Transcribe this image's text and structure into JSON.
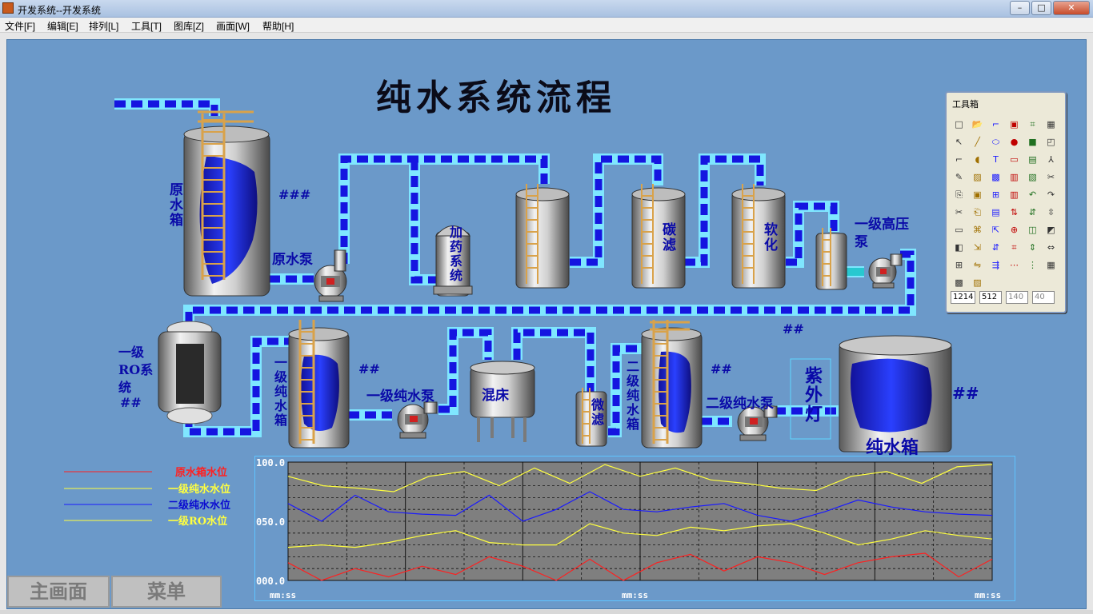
{
  "window": {
    "title": "开发系统--开发系统",
    "min": "–",
    "max": "□",
    "close": "✕"
  },
  "menu": [
    "文件[F]",
    "编辑[E]",
    "排列[L]",
    "工具[T]",
    "图库[Z]",
    "画面[W]",
    "帮助[H]"
  ],
  "screen": {
    "title": "纯水系统流程"
  },
  "labels": {
    "raw_tank": "原水箱",
    "raw_pump": "原水泵",
    "dosing": "加药系统",
    "carbon": "碳滤",
    "softener": "软化",
    "hp_pump": "一级高压泵",
    "ro": "一级RO系统",
    "p1_tank": "一级纯水箱",
    "p1_pump": "一级纯水泵",
    "mixed_bed": "混床",
    "micro": "微滤",
    "p2_tank": "二级纯水箱",
    "p2_pump": "二级纯水泵",
    "uv": "紫外灯",
    "pure_tank": "纯水箱"
  },
  "hash": {
    "raw": "###",
    "ro": "##",
    "p1": "##",
    "hp": "##",
    "p2": "##",
    "pure": "##"
  },
  "toolbox": {
    "title": "工具箱",
    "values": [
      "1214",
      "512",
      "140",
      "40"
    ]
  },
  "legend": [
    "原水箱水位",
    "一级纯水水位",
    "二级纯水水位",
    "一级RO水位"
  ],
  "buttons": {
    "main": "主画面",
    "menu": "菜单"
  },
  "chart_data": {
    "type": "line",
    "ylim": [
      0,
      100
    ],
    "yticks": [
      "100.0",
      "050.0",
      "000.0"
    ],
    "xticks": [
      "mm:ss",
      "mm:ss",
      "mm:ss"
    ],
    "series": [
      {
        "name": "原水箱水位",
        "color": "#ff2020",
        "values": [
          15,
          0,
          10,
          3,
          12,
          5,
          20,
          12,
          0,
          18,
          0,
          15,
          22,
          8,
          20,
          15,
          5,
          15,
          20,
          23,
          3,
          18
        ]
      },
      {
        "name": "一级纯水水位",
        "color": "#ffff40",
        "values": [
          88,
          80,
          78,
          75,
          88,
          92,
          80,
          95,
          82,
          98,
          88,
          95,
          85,
          82,
          78,
          76,
          88,
          92,
          82,
          96,
          98
        ]
      },
      {
        "name": "二级纯水水位",
        "color": "#1a1aff",
        "values": [
          65,
          50,
          72,
          58,
          56,
          55,
          72,
          50,
          60,
          75,
          60,
          58,
          62,
          65,
          55,
          50,
          58,
          68,
          62,
          58,
          56,
          55
        ]
      },
      {
        "name": "一级RO水位",
        "color": "#ffff40",
        "values": [
          28,
          30,
          28,
          32,
          38,
          42,
          32,
          30,
          30,
          48,
          40,
          38,
          45,
          42,
          46,
          48,
          40,
          30,
          35,
          42,
          38,
          35
        ]
      }
    ]
  }
}
